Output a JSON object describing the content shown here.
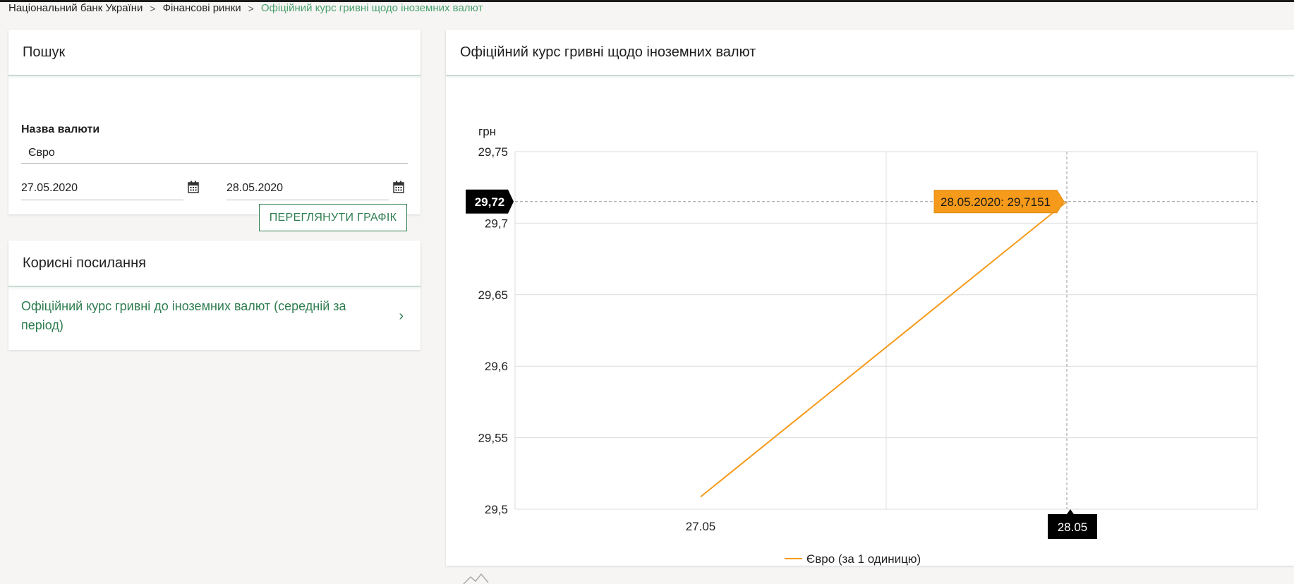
{
  "breadcrumb": {
    "items": [
      "Національний банк України",
      "Фінансові ринки"
    ],
    "current": "Офіційний курс гривні щодо іноземних валют",
    "separator": ">"
  },
  "search": {
    "title": "Пошук",
    "currency_label": "Назва валюти",
    "currency_value": "Євро",
    "date_from": "27.05.2020",
    "date_to": "28.05.2020",
    "button_label": "ПЕРЕГЛЯНУТИ ГРАФІК"
  },
  "links": {
    "title": "Корисні посилання",
    "items": [
      {
        "label": "Офіційний курс гривні до іноземних валют (середній за період)",
        "icon": "chevron-right-icon"
      }
    ]
  },
  "chart_panel": {
    "title": "Офіційний курс гривні щодо іноземних валют"
  },
  "chart_data": {
    "type": "line",
    "ylabel": "грн",
    "ylim": [
      29.5,
      29.75
    ],
    "yticks": [
      "29,5",
      "29,55",
      "29,6",
      "29,65",
      "29,7",
      "29,75"
    ],
    "ytick_values": [
      29.5,
      29.55,
      29.6,
      29.65,
      29.7,
      29.75
    ],
    "categories": [
      "27.05",
      "28.05"
    ],
    "grid": true,
    "legend_position": "bottom",
    "series": [
      {
        "name": "Євро (за 1 одиницю)",
        "color": "#f59a1a",
        "values": [
          29.5087,
          29.7151
        ]
      }
    ],
    "crosshair": {
      "y_label": "29,72",
      "x_label": "28.05"
    },
    "tooltip": "28.05.2020: 29,7151"
  },
  "colors": {
    "accent_green": "#2e7d4f",
    "link_green": "#4aa06e",
    "series_orange": "#f59a1a"
  }
}
